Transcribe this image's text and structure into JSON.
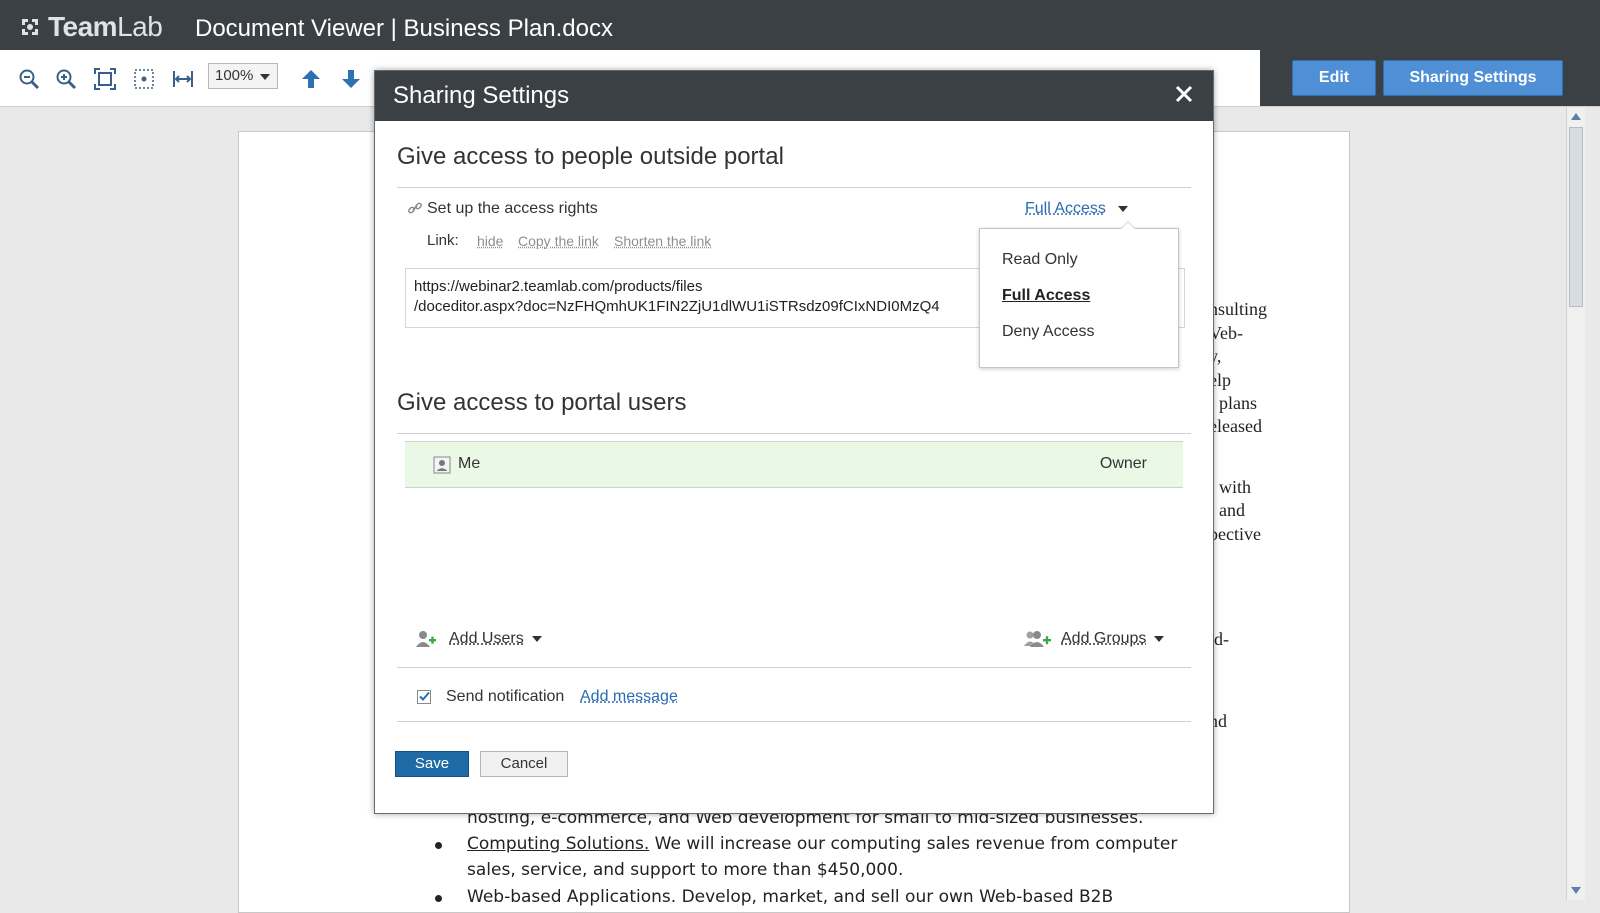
{
  "header": {
    "logo_brand_a": "Team",
    "logo_brand_b": "Lab",
    "title": "Document Viewer | Business Plan.docx"
  },
  "toolbar": {
    "zoom_value": "100%",
    "edit_label": "Edit",
    "sharing_settings_label": "Sharing Settings",
    "icons": [
      "zoom-out-icon",
      "zoom-in-icon",
      "fit-page-icon",
      "actual-size-icon",
      "fit-width-icon",
      "page-up-icon",
      "page-down-icon"
    ]
  },
  "document": {
    "fragments": [
      "nsulting",
      "Veb-",
      "y,",
      "elp",
      "plans",
      "eleased",
      "with",
      "and",
      "pective",
      "id-",
      "nd"
    ],
    "lines": [
      {
        "text": "hosting, e-commerce, and Web development for small to mid-sized businesses."
      },
      {
        "bullet": true,
        "lead": "Computing Solutions.",
        "text": " We will increase our computing sales revenue from computer"
      },
      {
        "text": "sales, service, and support to more than $450,000."
      },
      {
        "bullet": true,
        "text": "Web-based Applications. Develop, market, and sell our own Web-based B2B"
      }
    ]
  },
  "dialog": {
    "title": "Sharing Settings",
    "outside": {
      "heading": "Give access to people outside portal",
      "setup_label": "Set up the access rights",
      "access_value": "Full Access",
      "link_label": "Link:",
      "link_actions": [
        "hide",
        "Copy the link",
        "Shorten the link"
      ],
      "url_line1": "https://webinar2.teamlab.com/products/files",
      "url_line2": "/doceditor.aspx?doc=NzFHQmhUK1FIN2ZjU1dlWU1iSTRsdz09fCIxNDI0MzQ4",
      "access_options": [
        {
          "label": "Read Only",
          "selected": false
        },
        {
          "label": "Full Access",
          "selected": true
        },
        {
          "label": "Deny Access",
          "selected": false
        }
      ]
    },
    "portal": {
      "heading": "Give access to portal users",
      "users": [
        {
          "name": "Me",
          "role": "Owner"
        }
      ],
      "add_users_label": "Add Users",
      "add_groups_label": "Add Groups"
    },
    "notification": {
      "send_label": "Send notification",
      "checked": true,
      "add_message_label": "Add message"
    },
    "save_label": "Save",
    "cancel_label": "Cancel"
  },
  "colors": {
    "header_bg": "#3b4045",
    "primary_button": "#4f8fd6",
    "save_button": "#1d6aa6",
    "owner_row_bg": "#eaf8e6",
    "link": "#2a6cb0"
  }
}
